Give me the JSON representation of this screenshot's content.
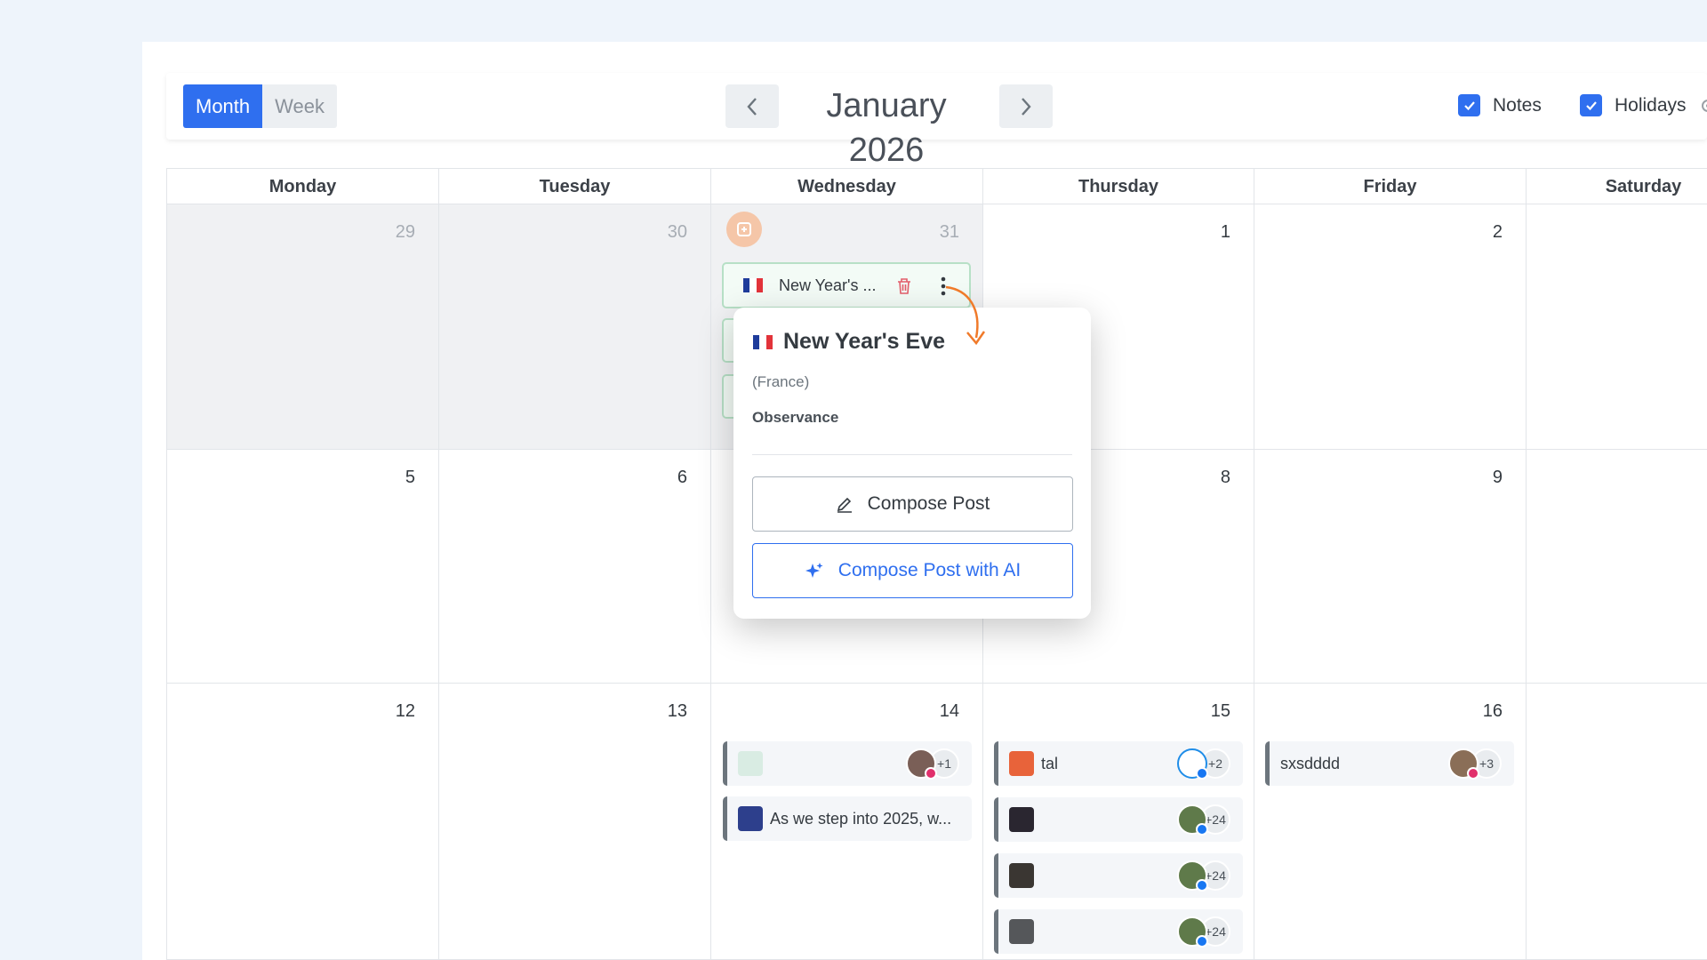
{
  "view_toggle": {
    "month": "Month",
    "week": "Week",
    "active": "Month"
  },
  "header": {
    "title": "January 2026"
  },
  "toggles": {
    "notes": "Notes",
    "holidays": "Holidays"
  },
  "weekdays": [
    "Monday",
    "Tuesday",
    "Wednesday",
    "Thursday",
    "Friday",
    "Saturday"
  ],
  "days": {
    "row1": [
      "29",
      "30",
      "31",
      "1",
      "2"
    ],
    "row2": [
      "5",
      "6",
      "8",
      "9"
    ],
    "row3": [
      "12",
      "13",
      "14",
      "15",
      "16"
    ]
  },
  "holiday_event": {
    "label": "New Year's ..."
  },
  "popover": {
    "title": "New Year's Eve",
    "country": "(France)",
    "type": "Observance",
    "compose": "Compose Post",
    "compose_ai": "Compose Post with AI"
  },
  "events": {
    "wed14": [
      {
        "text": "",
        "count": "+1"
      },
      {
        "text": "As we step into 2025, w...",
        "count": ""
      }
    ],
    "thu15": [
      {
        "text": "tal",
        "count": "+2"
      },
      {
        "text": "",
        "count": "+24"
      },
      {
        "text": "",
        "count": "+24"
      },
      {
        "text": "",
        "count": "+24"
      }
    ],
    "fri16": [
      {
        "text": "sxsdddd",
        "count": "+3"
      }
    ]
  },
  "colors": {
    "accent": "#2f6fef",
    "holiday_border": "#b7e0c6",
    "delete": "#e35d6a",
    "arrow": "#f07a2a"
  }
}
